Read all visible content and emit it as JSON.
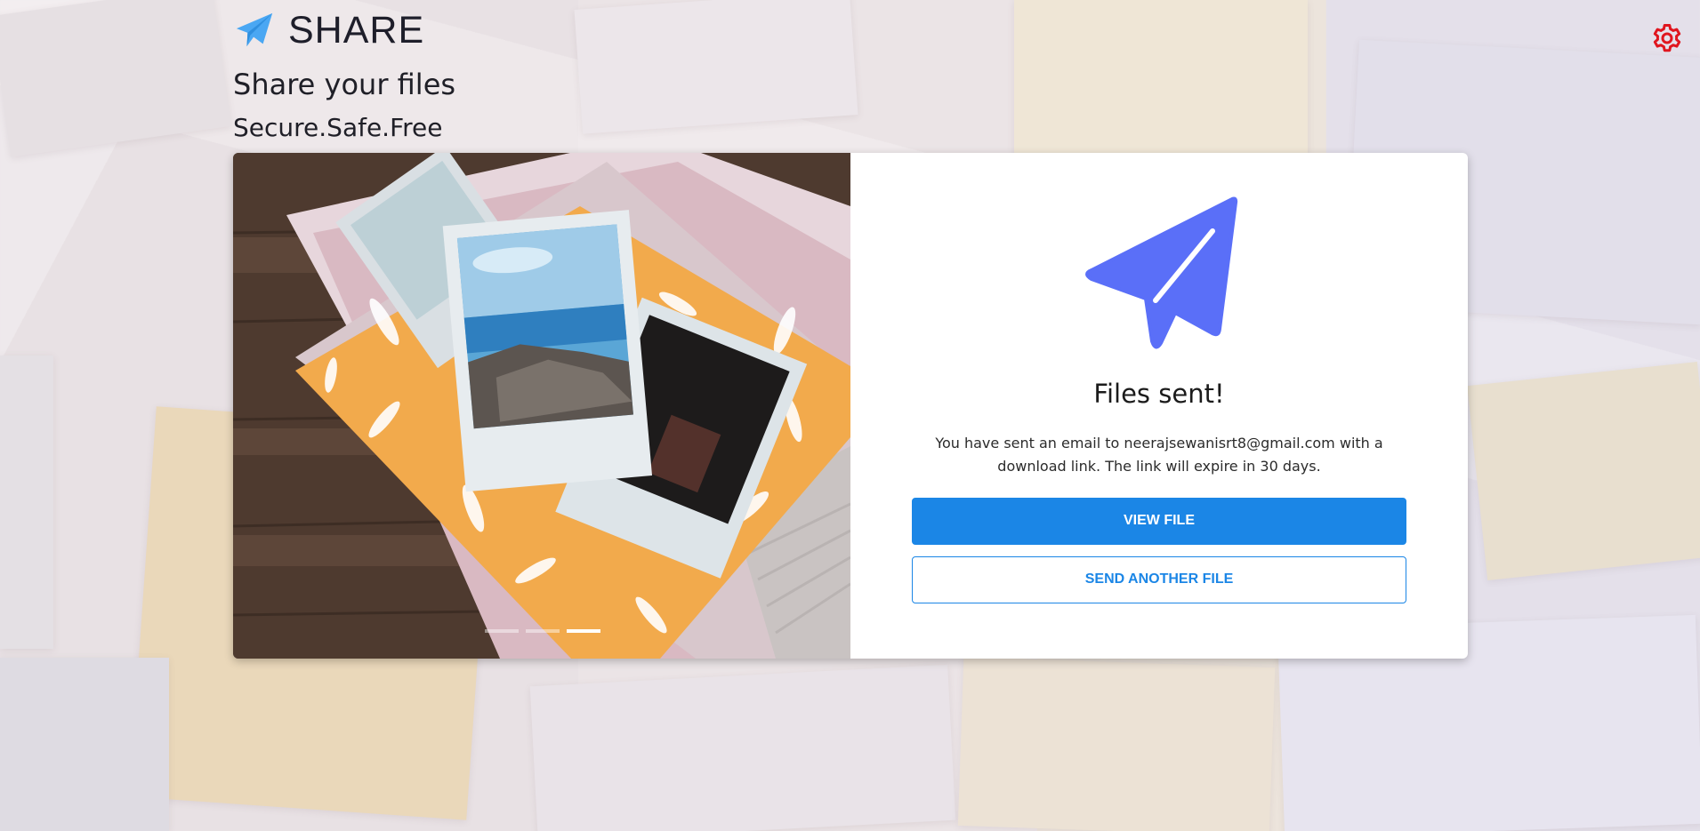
{
  "app": {
    "brand_name": "SHARE",
    "tagline": "Share your files",
    "subtagline": "Secure.Safe.Free",
    "brand_icon": "paper-plane-icon",
    "settings_icon": "gear-icon"
  },
  "carousel": {
    "image": "envelopes-and-instant-photos",
    "slides": [
      {
        "active": false
      },
      {
        "active": false
      },
      {
        "active": true
      }
    ]
  },
  "result": {
    "icon": "paper-plane-icon",
    "title": "Files sent!",
    "message": "You have sent an email to neerajsewanisrt8@gmail.com with a download link. The link will expire in 30 days.",
    "view_button": "VIEW FILE",
    "send_another_button": "SEND ANOTHER FILE"
  },
  "colors": {
    "accent": "#1b86e6",
    "plane": "#5a6ff8",
    "brand_plane": "#4aa7f3",
    "settings": "#e0161f"
  }
}
